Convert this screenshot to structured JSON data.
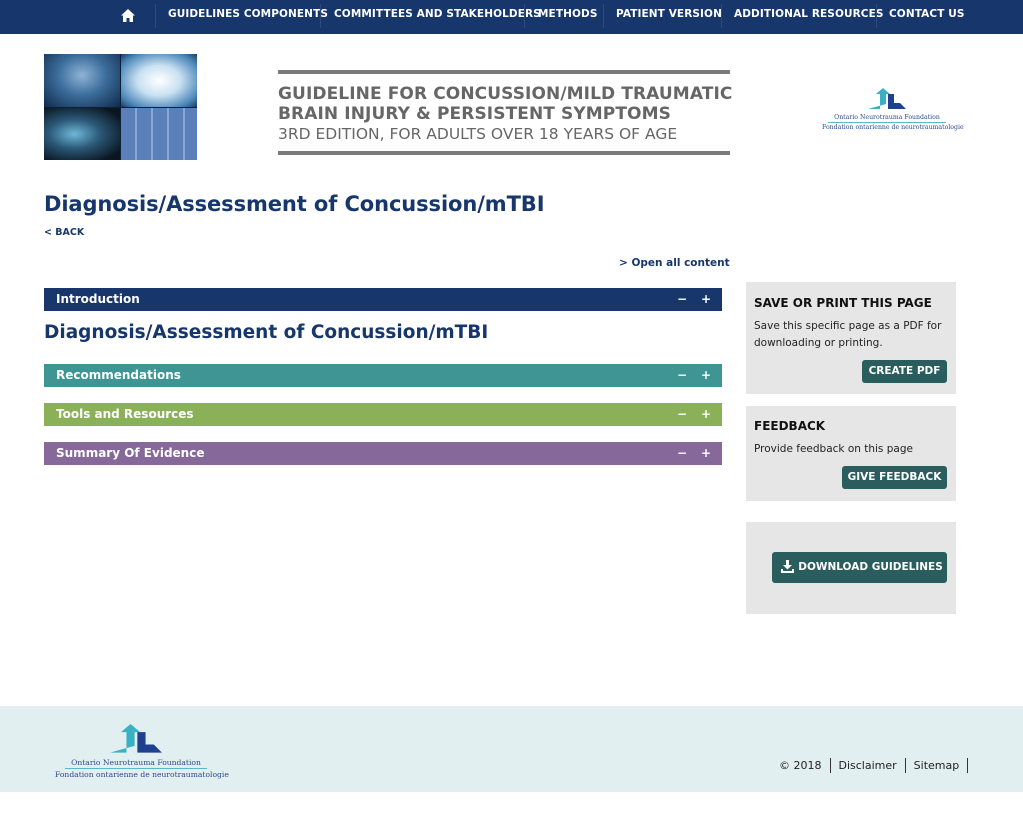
{
  "nav": {
    "home_icon": "home-icon",
    "items": [
      {
        "label": "GUIDELINES COMPONENTS"
      },
      {
        "label": "COMMITTEES AND STAKEHOLDERS"
      },
      {
        "label": "METHODS"
      },
      {
        "label": "PATIENT VERSION"
      },
      {
        "label": "ADDITIONAL RESOURCES"
      },
      {
        "label": "CONTACT US"
      }
    ],
    "bg_color": "#17366b"
  },
  "header": {
    "title_line1": "GUIDELINE FOR CONCUSSION/MILD TRAUMATIC",
    "title_line2": "BRAIN INJURY & PERSISTENT SYMPTOMS",
    "subtitle": "3RD EDITION, FOR ADULTS OVER 18 YEARS OF AGE",
    "logo": {
      "name_en": "Ontario Neurotrauma Foundation",
      "name_fr": "Fondation ontarienne de neurotraumatologie"
    }
  },
  "main": {
    "page_title": "Diagnosis/Assessment of Concussion/mTBI",
    "back_label": "< BACK",
    "open_all_label": "> Open all content",
    "section_title": "Diagnosis/Assessment of Concussion/mTBI",
    "accordions": [
      {
        "label": "Introduction",
        "color": "#17366b",
        "collapse": "−",
        "expand": "+"
      },
      {
        "label": "Recommendations",
        "color": "#3e9593",
        "collapse": "−",
        "expand": "+"
      },
      {
        "label": "Tools and Resources",
        "color": "#8bb158",
        "collapse": "−",
        "expand": "+"
      },
      {
        "label": "Summary Of Evidence",
        "color": "#86689b",
        "collapse": "−",
        "expand": "+"
      }
    ]
  },
  "sidebar": {
    "save": {
      "heading": "SAVE OR PRINT THIS PAGE",
      "text": "Save this specific page as a PDF for downloading or printing.",
      "button": "CREATE PDF"
    },
    "feedback": {
      "heading": "FEEDBACK",
      "text": "Provide feedback on this page",
      "button": "GIVE FEEDBACK"
    },
    "download": {
      "button": "DOWNLOAD GUIDELINES",
      "icon": "download-icon"
    },
    "button_color": "#2a5e5e"
  },
  "footer": {
    "logo": {
      "name_en": "Ontario Neurotrauma Foundation",
      "name_fr": "Fondation ontarienne de neurotraumatologie"
    },
    "copyright": "© 2018",
    "links": [
      {
        "label": "Disclaimer"
      },
      {
        "label": "Sitemap"
      }
    ]
  }
}
